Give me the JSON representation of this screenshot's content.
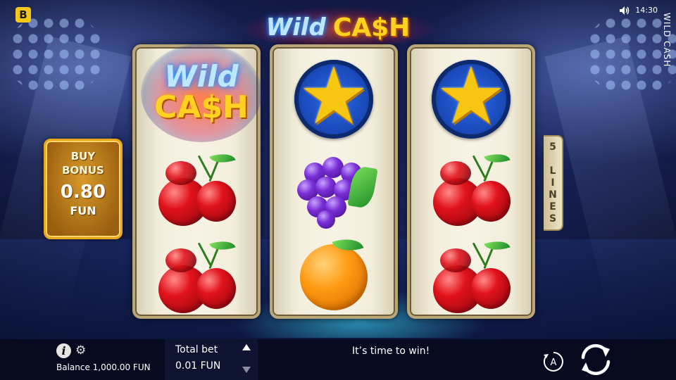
{
  "game": {
    "title": "WILD CASH",
    "logo_word1": "Wild",
    "logo_word2": "CA$H"
  },
  "brand": {
    "letter": "B"
  },
  "status": {
    "time": "14:30",
    "sound_icon": "speaker-icon"
  },
  "reels": [
    [
      "wild",
      "cherry",
      "cherry"
    ],
    [
      "star",
      "grapes",
      "orange"
    ],
    [
      "star",
      "cherry",
      "cherry"
    ]
  ],
  "buy_bonus": {
    "line1": "BUY",
    "line2": "BONUS",
    "amount": "0.80",
    "currency": "FUN"
  },
  "paylines": {
    "label": "5 LINES"
  },
  "bottom": {
    "balance": "Balance 1,000.00 FUN",
    "total_bet_label": "Total bet",
    "total_bet_value": "0.01 FUN",
    "message": "It’s time to win!",
    "autoplay_letter": "A"
  },
  "colors": {
    "brand_yellow": "#f5c71a",
    "cash_gold": "#ffd21f",
    "bonus_orange": "#e8a71b",
    "reel_frame": "#b9a77a"
  }
}
